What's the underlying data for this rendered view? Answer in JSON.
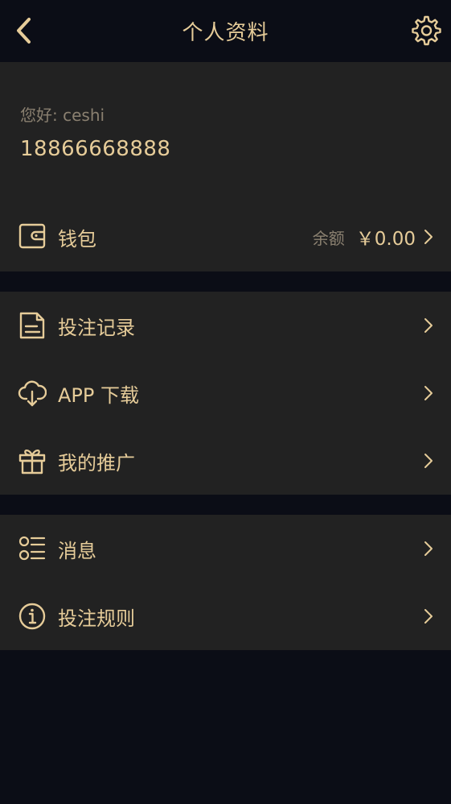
{
  "header": {
    "title": "个人资料",
    "back_icon": "chevron-left-icon",
    "settings_icon": "gear-icon"
  },
  "profile": {
    "greeting": "您好: ceshi",
    "phone": "18866668888",
    "wallet": {
      "label": "钱包",
      "balance_label": "余额",
      "balance_value": "￥0.00"
    }
  },
  "menu_group1": [
    {
      "label": "投注记录",
      "icon": "document-list-icon"
    },
    {
      "label": "APP 下载",
      "icon": "cloud-download-icon"
    },
    {
      "label": "我的推广",
      "icon": "gift-icon"
    }
  ],
  "menu_group2": [
    {
      "label": "消息",
      "icon": "list-bullets-icon"
    },
    {
      "label": "投注规则",
      "icon": "info-icon"
    }
  ],
  "colors": {
    "accent": "#e6cc99",
    "background": "#0b0d16",
    "card": "#222222",
    "muted": "#8a8070"
  }
}
